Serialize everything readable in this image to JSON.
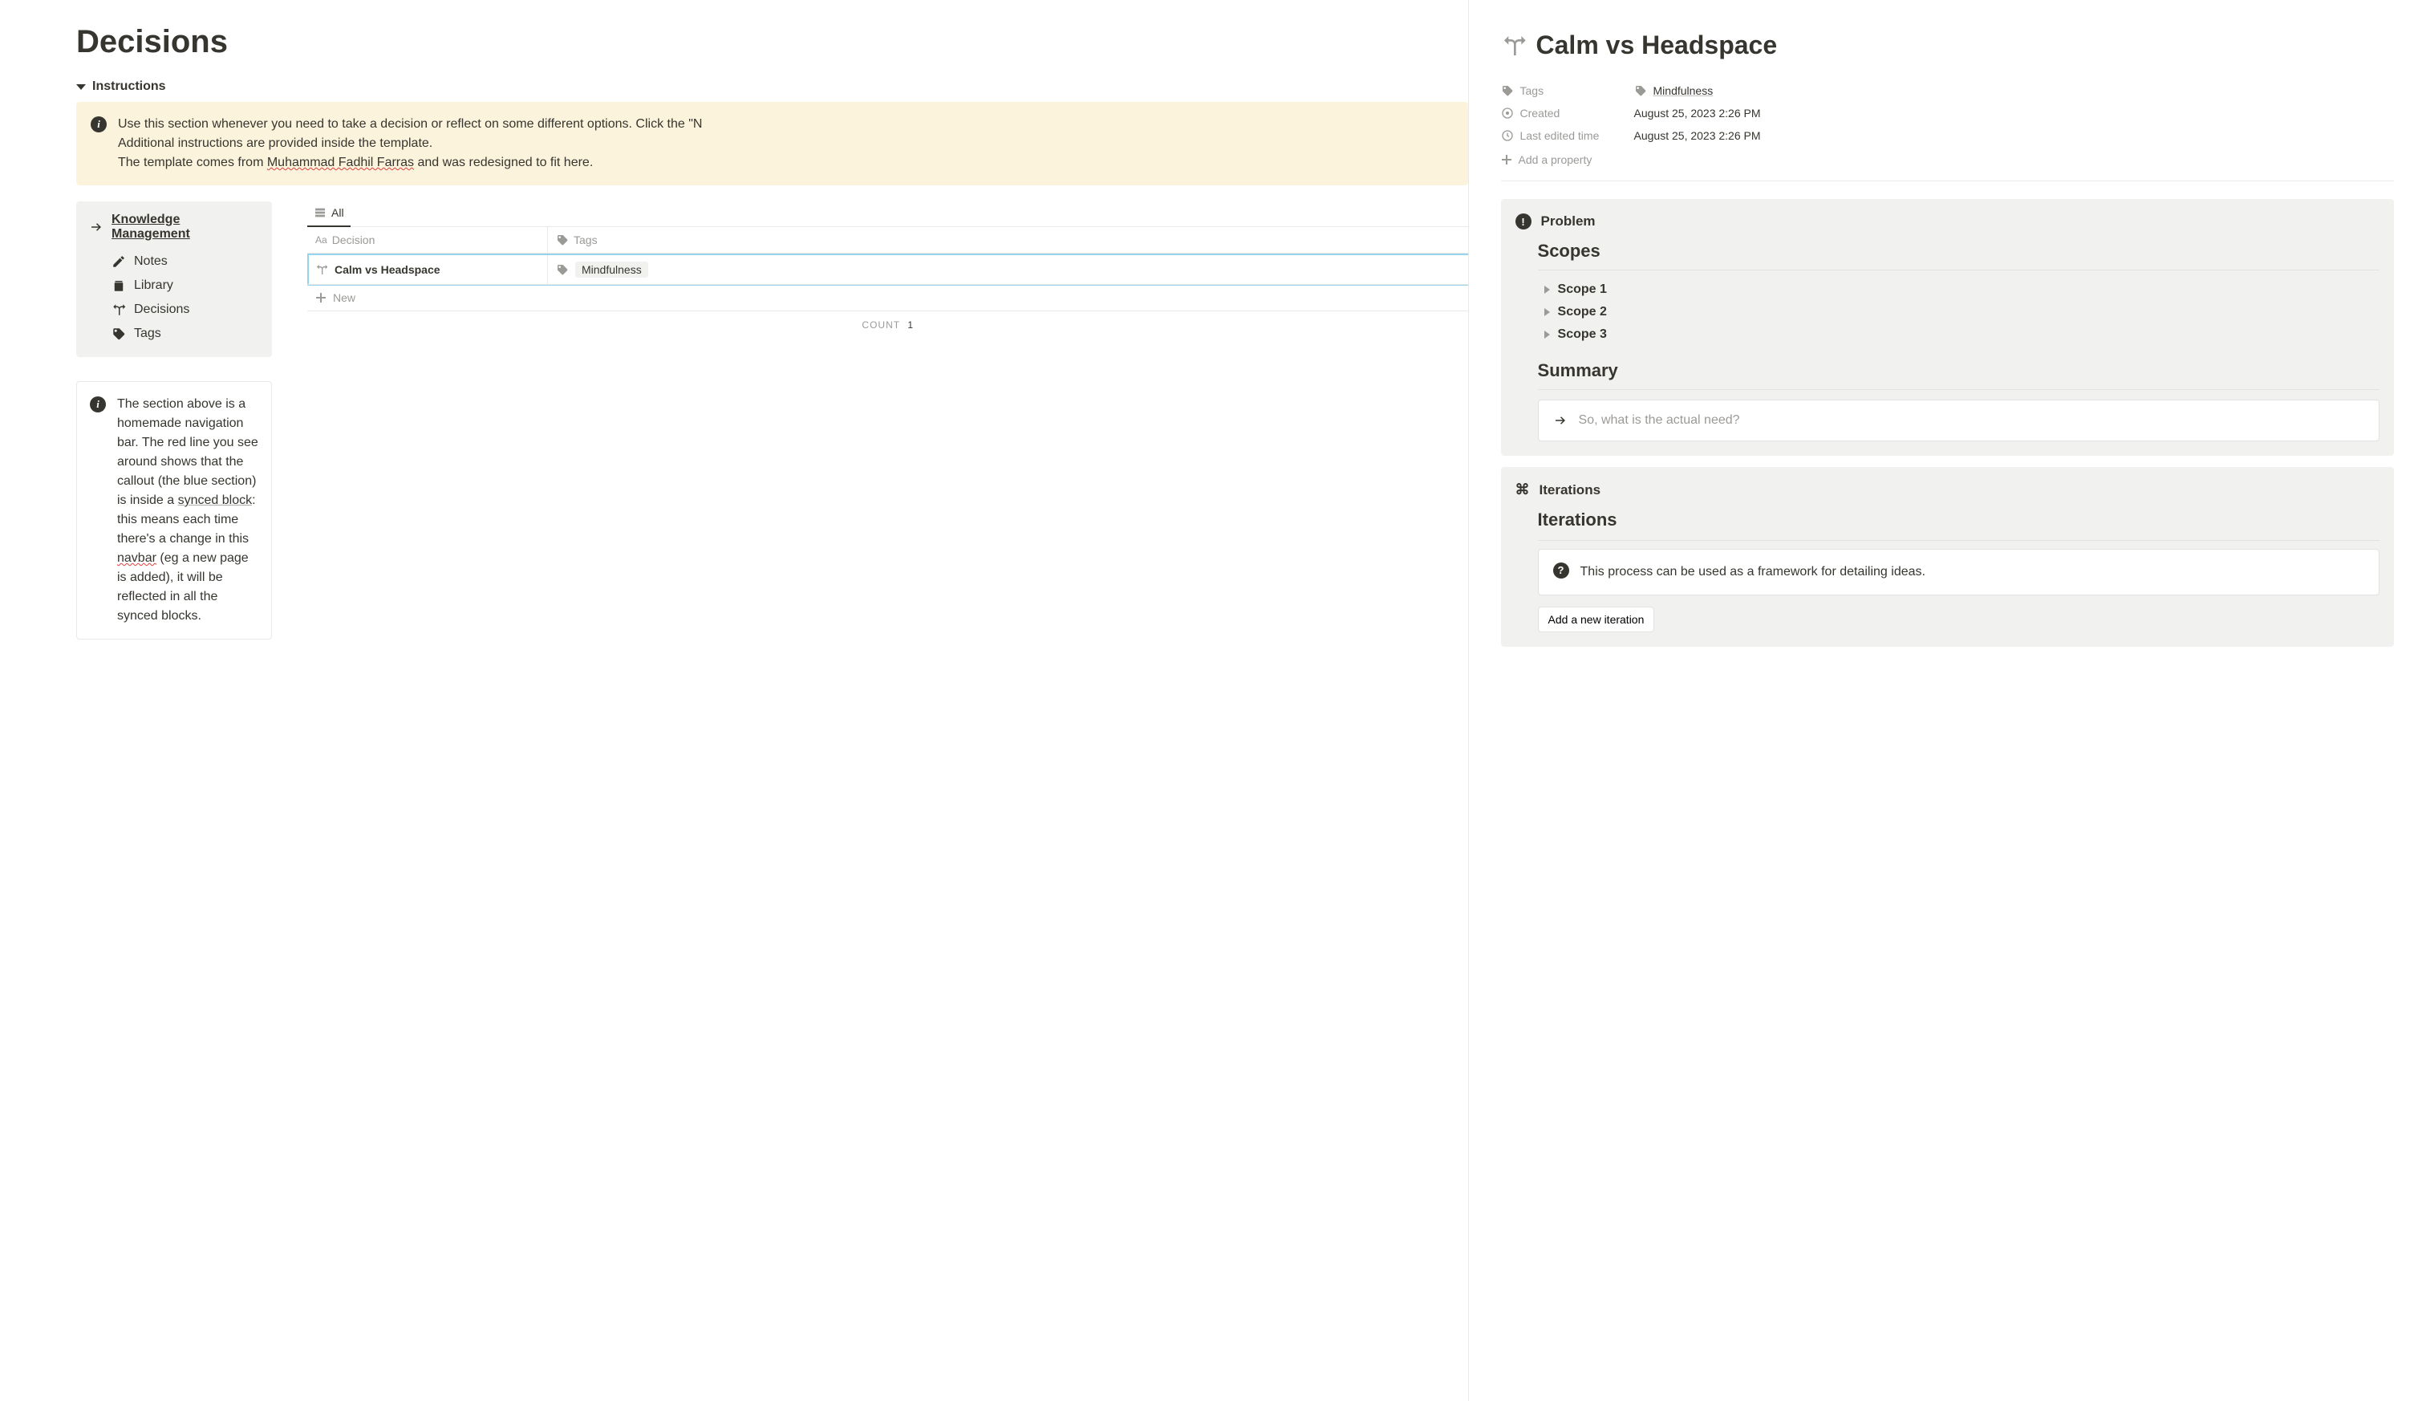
{
  "page": {
    "title": "Decisions",
    "instructions_label": "Instructions",
    "callout_line1": "Use this section whenever you need to take a decision or reflect on some different options. Click the \"N",
    "callout_line2": "Additional instructions are provided inside the template.",
    "callout_line3a": "The template comes from ",
    "callout_line3_link": "Muhammad Fadhil Farras",
    "callout_line3b": " and was redesigned to fit here."
  },
  "nav": {
    "header": "Knowledge Management",
    "items": [
      {
        "label": "Notes"
      },
      {
        "label": "Library"
      },
      {
        "label": "Decisions"
      },
      {
        "label": "Tags"
      }
    ]
  },
  "info_card": {
    "text_a": "The section above is a homemade navigation bar. The red line you see around shows that the callout (the blue section) is inside a ",
    "link": "synced block",
    "text_b": ": this means each time there's a change in this ",
    "nav_word": "navbar",
    "text_c": " (eg a new page is added), it will be reflected in all the synced blocks."
  },
  "db": {
    "view_tab": "All",
    "col_decision": "Decision",
    "col_tags": "Tags",
    "rows": [
      {
        "title": "Calm vs Headspace",
        "tag": "Mindfulness"
      }
    ],
    "new_label": "New",
    "count_label": "COUNT",
    "count_value": "1"
  },
  "detail": {
    "title": "Calm vs Headspace",
    "props": {
      "tags_label": "Tags",
      "tags_value": "Mindfulness",
      "created_label": "Created",
      "created_value": "August 25, 2023 2:26 PM",
      "edited_label": "Last edited time",
      "edited_value": "August 25, 2023 2:26 PM"
    },
    "add_property": "Add a property",
    "problem_label": "Problem",
    "scopes_heading": "Scopes",
    "scopes": [
      "Scope 1",
      "Scope 2",
      "Scope 3"
    ],
    "summary_heading": "Summary",
    "need_prompt": "So, what is the actual need?",
    "iterations_label": "Iterations",
    "iterations_heading": "Iterations",
    "iterations_text": "This process can be used as a framework for detailing ideas.",
    "add_iteration": "Add a new iteration"
  }
}
